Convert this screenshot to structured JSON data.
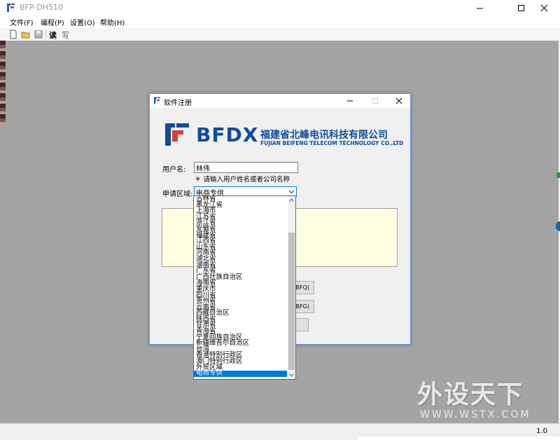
{
  "window": {
    "title": "BFP-DH510"
  },
  "menu": [
    "文件(F)",
    "编程(P)",
    "设置(O)",
    "帮助(H)"
  ],
  "toolbar": {
    "read_label": "读",
    "write_label": "写"
  },
  "dialog": {
    "title": "软件注册",
    "brand": {
      "name": "BFDX",
      "cn": "福建省北峰电讯科技有限公司",
      "en": "FUJIAN BEIFENG TELECOM TECHNOLOGY CO.,LTD"
    },
    "username_label": "用户名:",
    "username_value": "林伟",
    "hint": "＊ 请输入用户姓名或者公司名称",
    "region_label": "申请区域:",
    "region_value": "电商专供",
    "button1_label": "BFQ)",
    "button2_label": "BFG)"
  },
  "dropdown": {
    "items": [
      "吉林省",
      "黑龙江省",
      "上海市",
      "江苏省",
      "浙江省",
      "安徽省",
      "福建省",
      "江西省",
      "山东省",
      "河南省",
      "湖北省",
      "湖南省",
      "广东省",
      "广西壮族自治区",
      "海南省",
      "重庆市",
      "四川省",
      "贵州省",
      "云南省",
      "西藏自治区",
      "陕西省",
      "甘肃省",
      "青海省",
      "宁夏回族自治区",
      "新疆维吾尔自治区",
      "台湾",
      "香港特别行政区",
      "澳门特别行政区",
      "外贸区域",
      "电商专供"
    ],
    "selected_index": 29
  },
  "status": {
    "version": "1.0"
  },
  "watermark": {
    "cn": "外设天下",
    "en": "WWW.WSTX.COM"
  },
  "colors": {
    "accent": "#0078d7",
    "brand": "#0f4c9c",
    "workspace": "#a4a4a4"
  }
}
